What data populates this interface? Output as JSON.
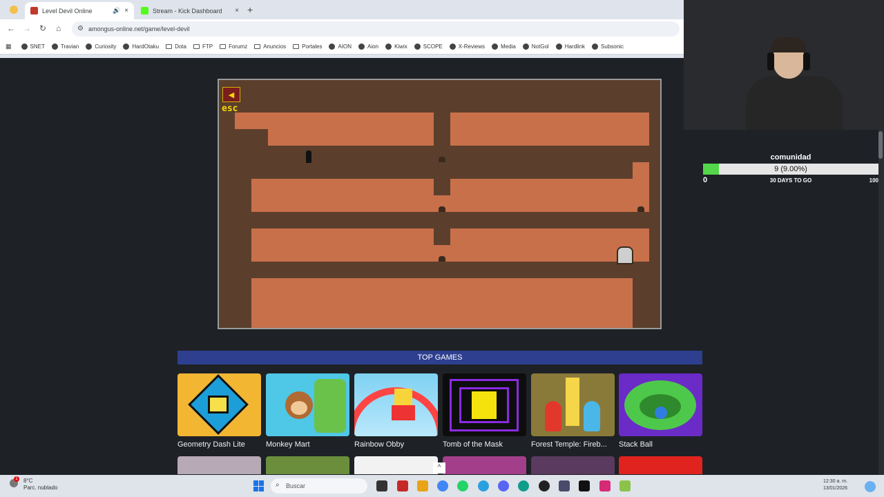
{
  "browser": {
    "tabs": [
      {
        "title": "Level Devil Online",
        "active": true
      },
      {
        "title": "Stream - Kick Dashboard",
        "active": false
      }
    ],
    "new_tab": "+",
    "close": "×",
    "url": "amongus-online.net/game/level-devil",
    "bookmarks": [
      "SNET",
      "Travian",
      "Curiosity",
      "HardOtaku",
      "Dota",
      "FTP",
      "Forumz",
      "Anuncios",
      "Portales",
      "AION",
      "Aion",
      "Kiwix",
      "SCOPE",
      "X-Reviews",
      "Media",
      "NotGol",
      "Hardlink",
      "Subsonic"
    ]
  },
  "game": {
    "esc_label": "esc"
  },
  "top_games": {
    "heading": "TOP GAMES",
    "items": [
      {
        "name": "Geometry Dash Lite"
      },
      {
        "name": "Monkey Mart"
      },
      {
        "name": "Rainbow Obby"
      },
      {
        "name": "Tomb of the Mask"
      },
      {
        "name": "Forest Temple: Fireb..."
      },
      {
        "name": "Stack Ball"
      }
    ]
  },
  "goal": {
    "title": "comunidad",
    "progress_text": "9 (9.00%)",
    "progress_fraction": 0.09,
    "min": "0",
    "days_text": "30 DAYS TO GO",
    "max": "100"
  },
  "taskbar": {
    "weather_temp": "8°C",
    "weather_desc": "Parc. nublado",
    "weather_badge": "1",
    "search_placeholder": "Buscar",
    "time": "12:30 a. m.",
    "date": "13/01/2026"
  },
  "colors": {
    "game_bg": "#5b3f2c",
    "game_floor": "#c8704a",
    "top_games_banner": "#2e3f8f",
    "goal_fill": "#53d64a"
  }
}
